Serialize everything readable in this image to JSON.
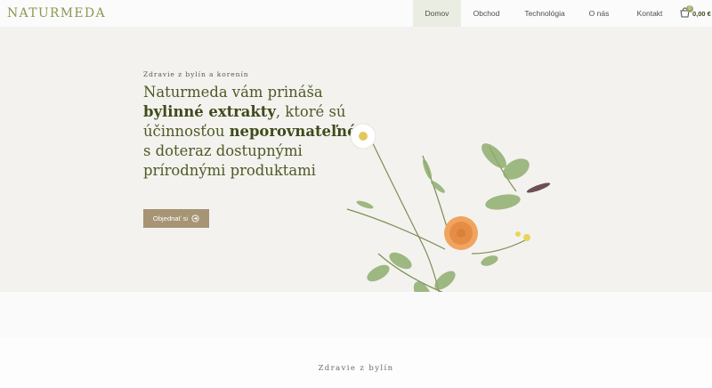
{
  "header": {
    "logo_text": "NATURMEDA",
    "nav": [
      {
        "label": "Domov",
        "active": true
      },
      {
        "label": "Obchod",
        "active": false
      },
      {
        "label": "Technológia",
        "active": false
      },
      {
        "label": "O nás",
        "active": false
      },
      {
        "label": "Kontakt",
        "active": false
      }
    ],
    "cart": {
      "count": "0",
      "total": "0,00 €",
      "icon": "shopping-bag-icon"
    }
  },
  "hero": {
    "subtitle": "Zdravie z bylín a korenín",
    "headline": {
      "t1": "Naturmeda vám prináša ",
      "b1": "bylinné extrakty",
      "t2": ", ktoré sú účinnosťou ",
      "b2": "neporovnateľné",
      "t3": " s doteraz dostupnými prírodnými produktami"
    },
    "cta_label": "Objednať si",
    "cta_icon": "arrow-circle-right-icon"
  },
  "section": {
    "title": "Zdravie z bylín"
  },
  "colors": {
    "brand": "#8a9a4e",
    "headline": "#4d5a25",
    "button": "#a69474",
    "active_nav_bg": "#e9ede2"
  }
}
